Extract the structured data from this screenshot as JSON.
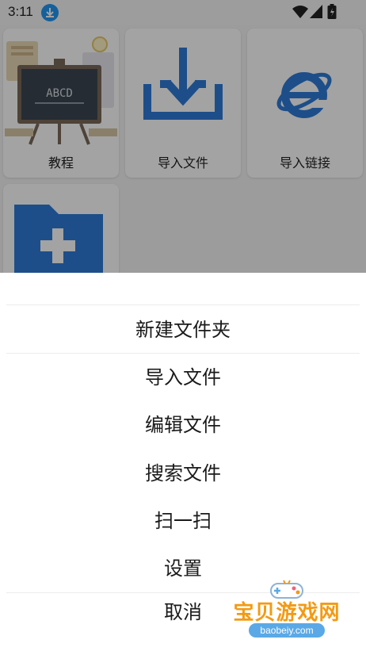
{
  "status_bar": {
    "time": "3:11",
    "download_icon": "download-icon",
    "wifi_icon": "wifi-icon",
    "signal_icon": "signal-icon",
    "battery_icon": "battery-icon"
  },
  "grid": {
    "tiles": [
      {
        "label": "教程",
        "icon": "chalkboard-icon",
        "board_text": "ABCD"
      },
      {
        "label": "导入文件",
        "icon": "import-tray-icon"
      },
      {
        "label": "导入链接",
        "icon": "browser-e-icon"
      },
      {
        "label": "",
        "icon": "new-folder-plus-icon"
      }
    ]
  },
  "menu": {
    "items": [
      {
        "label": "新建文件夹"
      },
      {
        "label": "导入文件"
      },
      {
        "label": "编辑文件"
      },
      {
        "label": "搜索文件"
      },
      {
        "label": "扫一扫"
      },
      {
        "label": "设置"
      }
    ],
    "cancel": "取消"
  },
  "watermark": {
    "name": "宝贝游戏网",
    "url": "baobeiy.com"
  },
  "colors": {
    "accent_blue": "#2e7bd6",
    "watermark_orange": "#f39a13"
  }
}
